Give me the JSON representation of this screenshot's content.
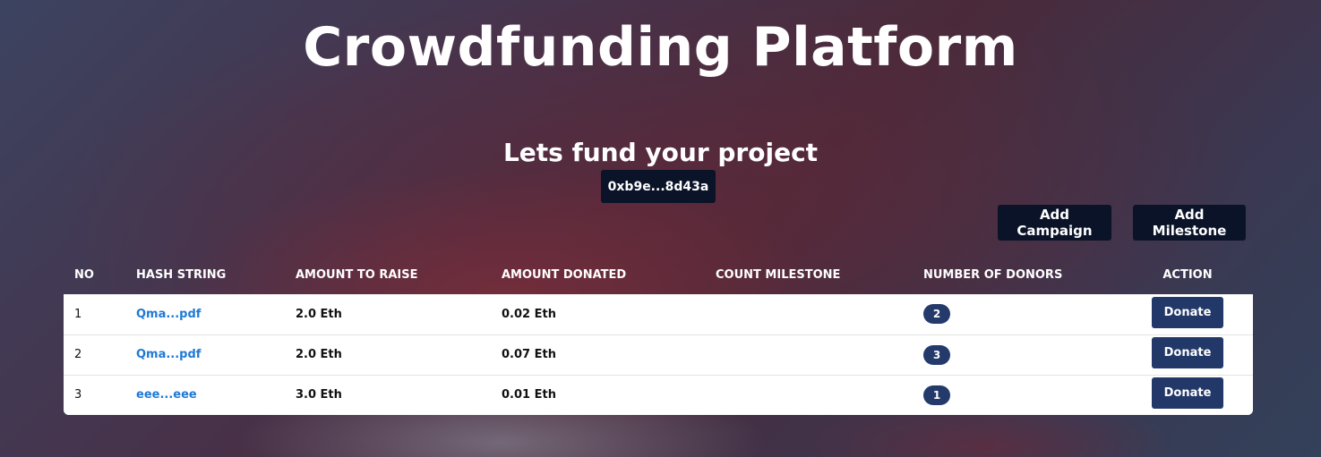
{
  "header": {
    "title": "Crowdfunding Platform",
    "subtitle": "Lets fund your project",
    "wallet_address": "0xb9e...8d43a"
  },
  "toolbar": {
    "add_campaign_label": "Add Campaign",
    "add_milestone_label": "Add Milestone"
  },
  "table": {
    "columns": [
      "NO",
      "HASH STRING",
      "AMOUNT TO RAISE",
      "AMOUNT DONATED",
      "COUNT MILESTONE",
      "NUMBER OF DONORS",
      "ACTION"
    ],
    "rows": [
      {
        "no": "1",
        "hash": "Qma...pdf",
        "raise": "2.0 Eth",
        "donated": "0.02 Eth",
        "milestones": "",
        "donors": "2",
        "action": "Donate"
      },
      {
        "no": "2",
        "hash": "Qma...pdf",
        "raise": "2.0 Eth",
        "donated": "0.07 Eth",
        "milestones": "",
        "donors": "3",
        "action": "Donate"
      },
      {
        "no": "3",
        "hash": "eee...eee",
        "raise": "3.0 Eth",
        "donated": "0.01 Eth",
        "milestones": "",
        "donors": "1",
        "action": "Donate"
      }
    ]
  },
  "colors": {
    "dark_button": "#0b1328",
    "donate_button": "#223868",
    "badge": "#233a6b",
    "link": "#1f7ad6"
  }
}
